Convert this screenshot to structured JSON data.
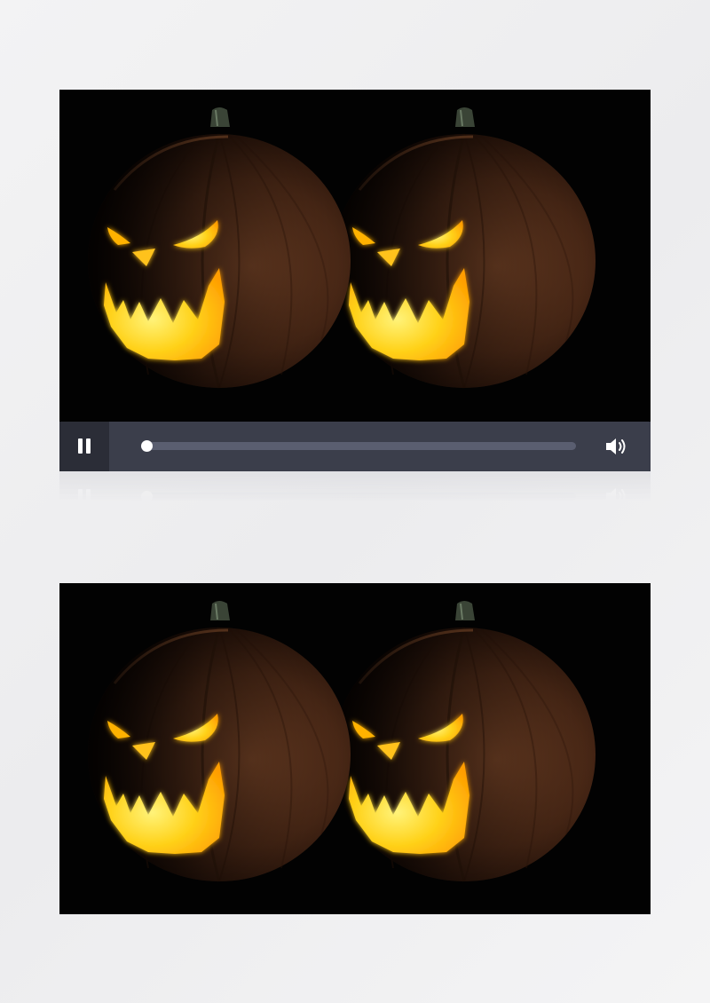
{
  "player": {
    "state": "paused",
    "progress": 0.0,
    "pause_icon": "pause-icon",
    "volume_icon": "volume-icon"
  },
  "colors": {
    "page_background": "#efeff1",
    "video_background": "#020202",
    "control_bar": "#3b3e4b",
    "play_button_bg": "#2b2d37",
    "track": "#5a5e70",
    "knob": "#ffffff",
    "pumpkin_glow": "#ffd21a"
  },
  "scene": {
    "subject": "two-jack-o-lanterns"
  }
}
